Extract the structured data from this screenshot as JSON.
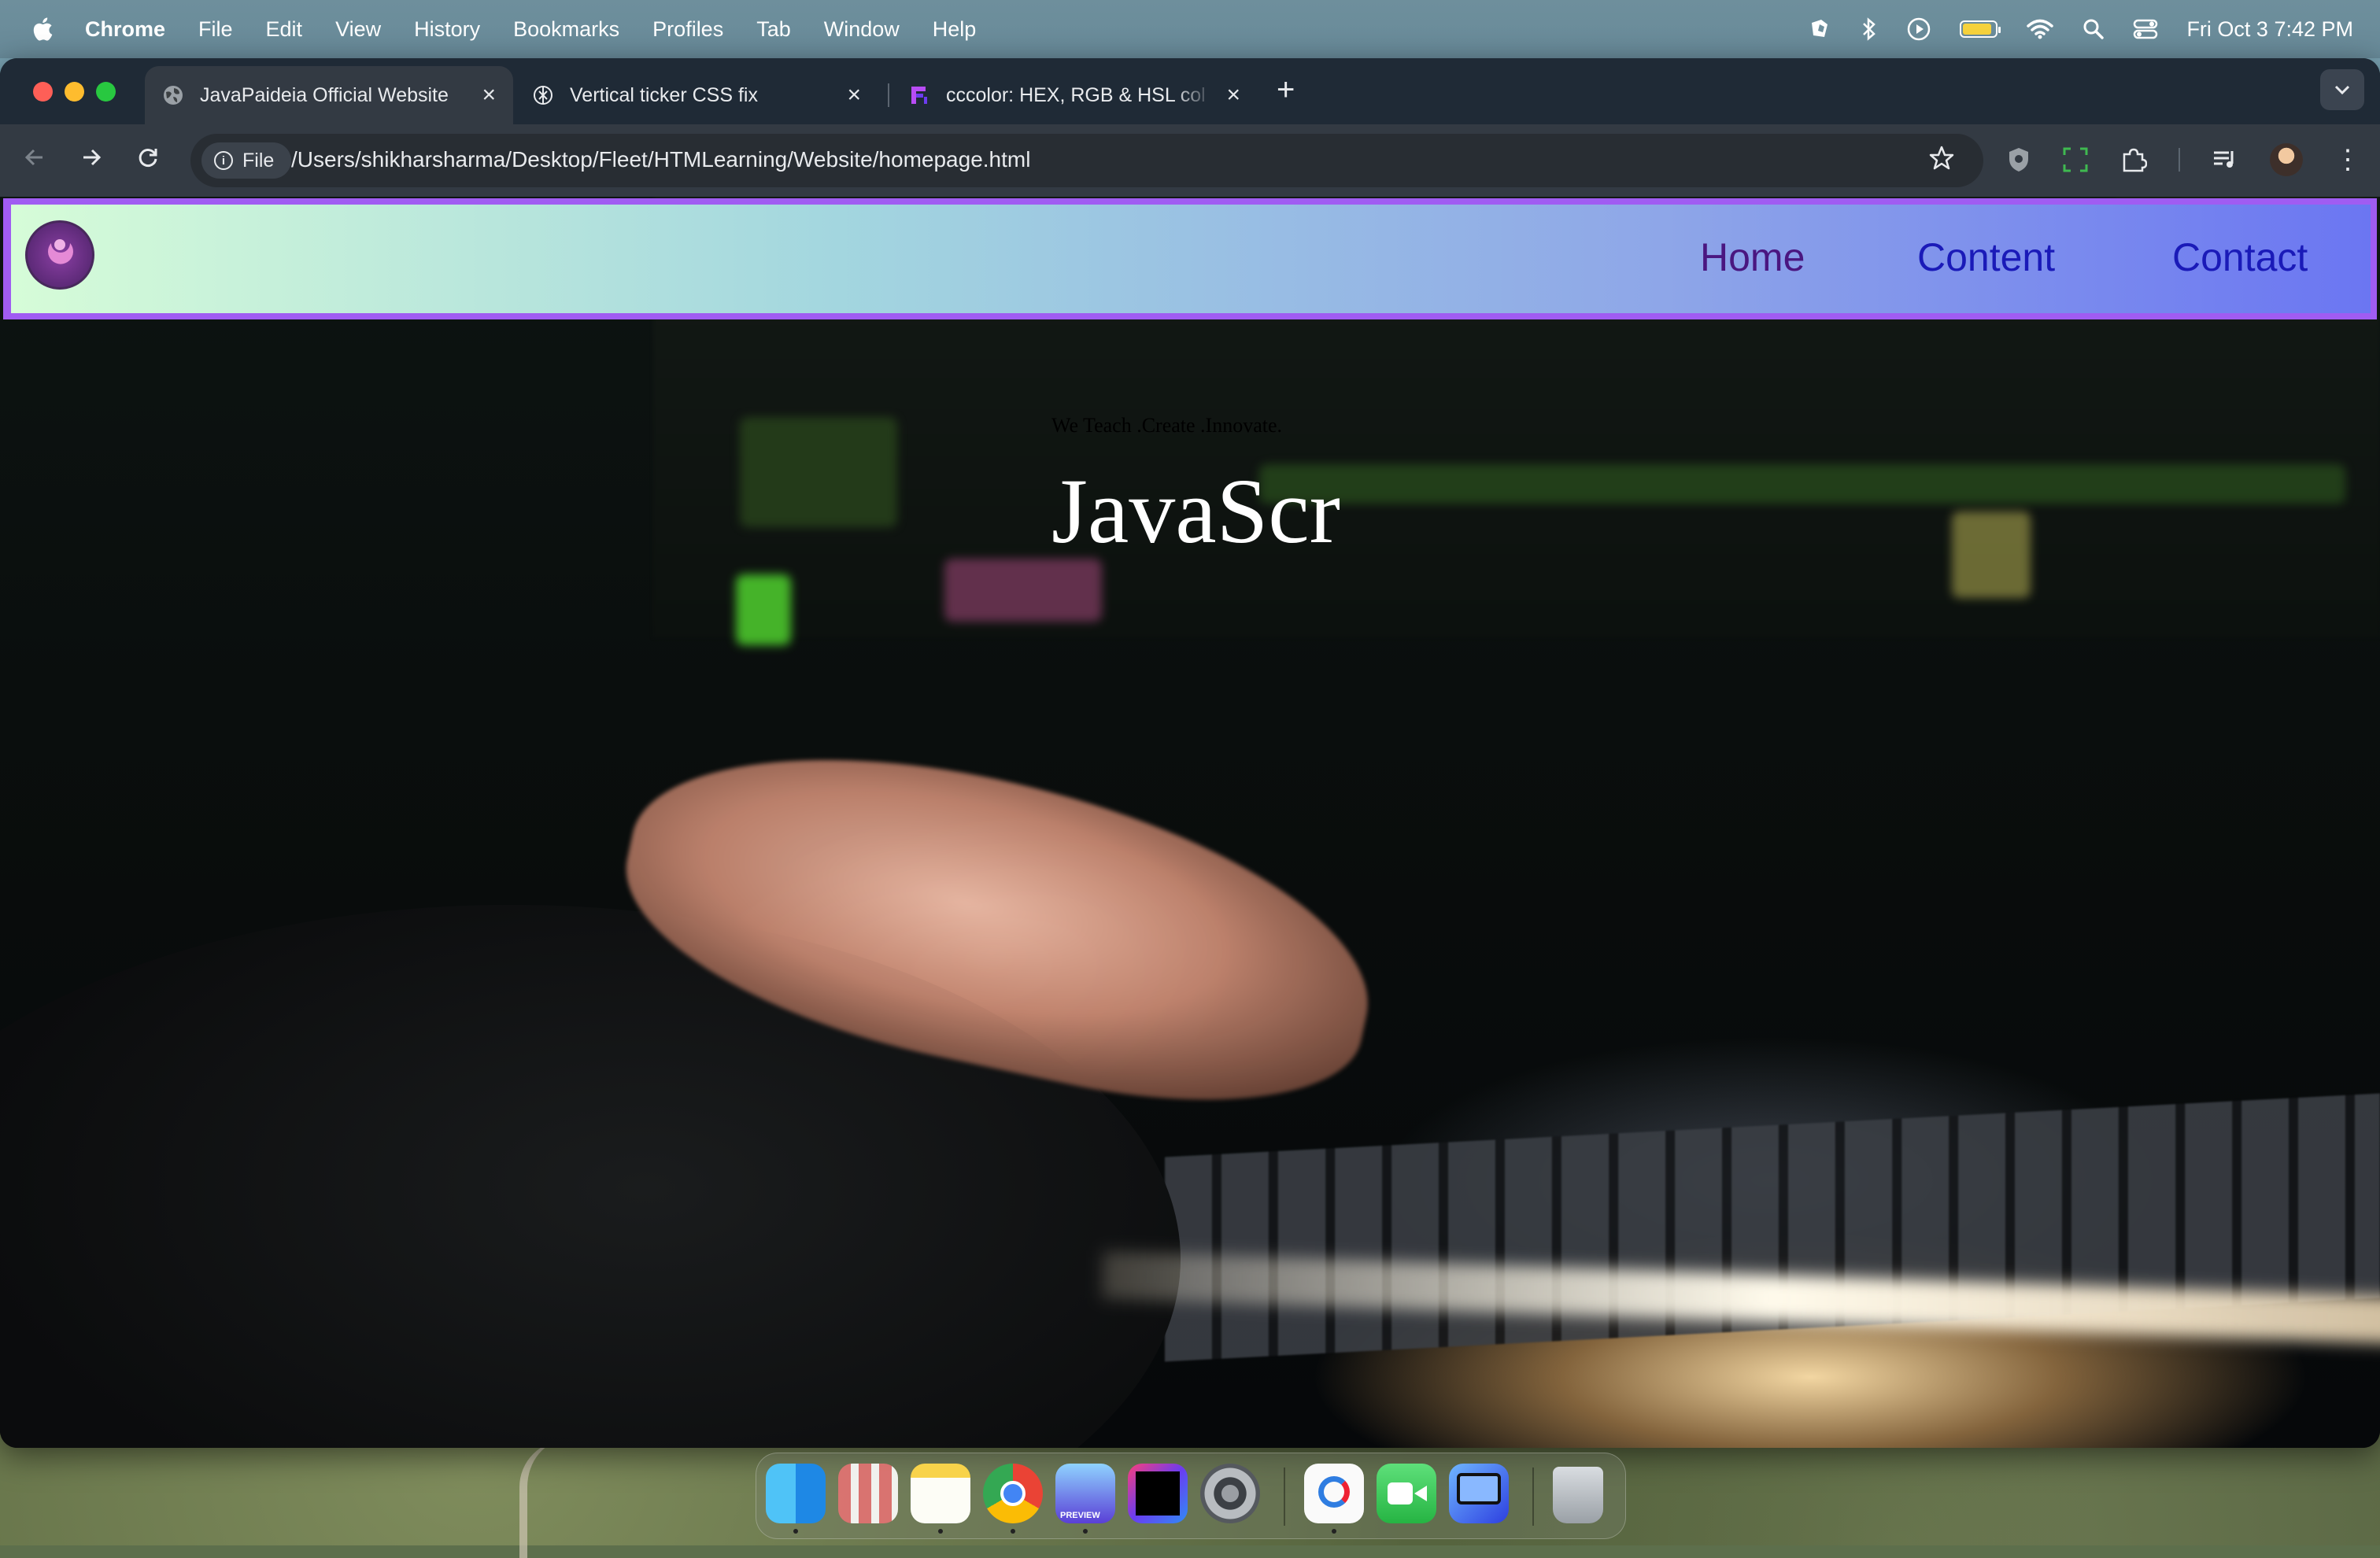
{
  "menubar": {
    "app_name": "Chrome",
    "items": [
      "File",
      "Edit",
      "View",
      "History",
      "Bookmarks",
      "Profiles",
      "Tab",
      "Window",
      "Help"
    ],
    "clock": "Fri Oct 3  7:42 PM",
    "status_icons": [
      "extension-icon",
      "bluetooth-icon",
      "play-icon",
      "battery-icon",
      "wifi-icon",
      "search-icon",
      "control-center-icon"
    ]
  },
  "tabs": [
    {
      "title": "JavaPaideia Official Website",
      "favicon": "globe-icon",
      "active": true
    },
    {
      "title": "Vertical ticker CSS fix",
      "favicon": "chatgpt-icon",
      "active": false
    },
    {
      "title": "cccolor: HEX, RGB & HSL col",
      "favicon": "cccolor-icon",
      "active": false
    }
  ],
  "toolbar": {
    "scheme_chip": "File",
    "url": "/Users/shikharsharma/Desktop/Fleet/HTMLearning/Website/homepage.html"
  },
  "page": {
    "nav": [
      "Home",
      "Content",
      "Contact"
    ],
    "tagline": "We Teach .Create .Innovate.",
    "hero_title": "JavaScr",
    "colors": {
      "nav_gradient_start": "#d6fcd8",
      "nav_gradient_end": "#6b76f2",
      "nav_border": "#a05cf2",
      "nav_home": "#4a1680",
      "nav_link": "#1a1ab8"
    }
  },
  "dock": {
    "apps": [
      "finder-icon",
      "launchpad-icon",
      "notes-icon",
      "chrome-icon",
      "safari-preview-icon",
      "intellij-icon",
      "system-settings-icon",
      "preview-icon",
      "facetime-icon",
      "screen-sharing-icon",
      "trash-icon"
    ],
    "preview_badge": "PREVIEW"
  }
}
